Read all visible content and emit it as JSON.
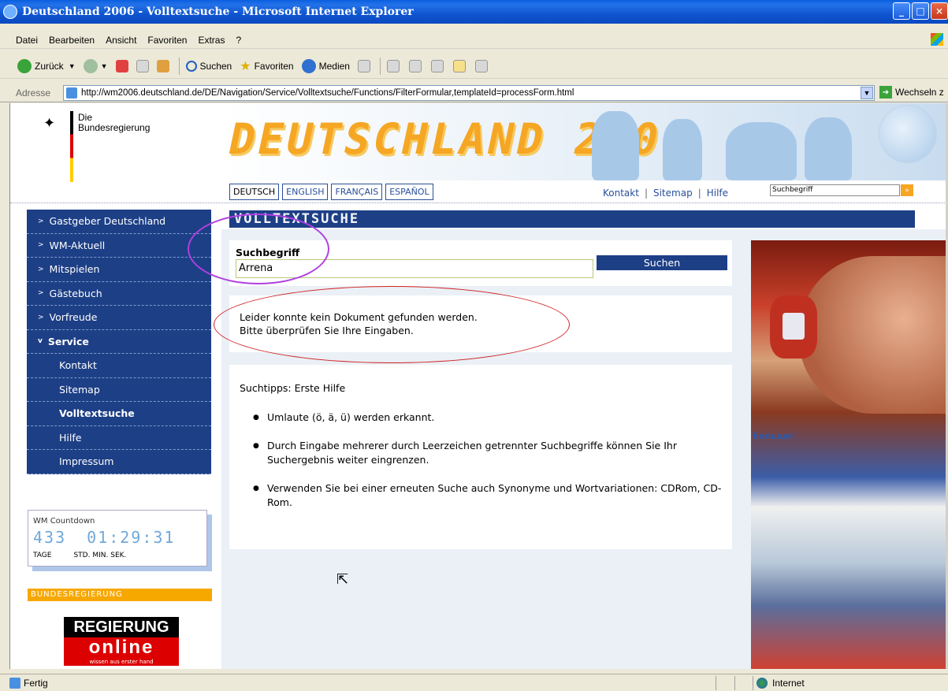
{
  "window": {
    "title": "Deutschland 2006 - Volltextsuche - Microsoft Internet Explorer",
    "buttons": [
      "_",
      "□",
      "×"
    ]
  },
  "menu": [
    "Datei",
    "Bearbeiten",
    "Ansicht",
    "Favoriten",
    "Extras",
    "?"
  ],
  "toolbar": {
    "back": "Zurück",
    "search": "Suchen",
    "favorites": "Favoriten",
    "media": "Medien"
  },
  "address": {
    "label": "Adresse",
    "url": "http://wm2006.deutschland.de/DE/Navigation/Service/Volltextsuche/Functions/FilterFormular,templateId=processForm.html",
    "go": "Wechseln z"
  },
  "header": {
    "logo_line1": "Die",
    "logo_line2": "Bundesregierung",
    "banner": "DEUTSCHLAND 2006",
    "langs": [
      "DEUTSCH",
      "ENGLISH",
      "FRANÇAIS",
      "ESPAÑOL"
    ],
    "links": [
      "Kontakt",
      "Sitemap",
      "Hilfe"
    ],
    "search_placeholder": "Suchbegriff"
  },
  "nav": {
    "items": [
      "Gastgeber Deutschland",
      "WM-Aktuell",
      "Mitspielen",
      "Gästebuch",
      "Vorfreude",
      "Service"
    ],
    "sub": [
      "Kontakt",
      "Sitemap",
      "Volltextsuche",
      "Hilfe",
      "Impressum"
    ]
  },
  "countdown": {
    "title": "WM Countdown",
    "days": "433",
    "time": "01:29:31",
    "labels": [
      "TAGE",
      "STD.",
      "MIN.",
      "SEK."
    ]
  },
  "bundesregierung": {
    "label": "BUNDESREGIERUNG",
    "line1": "REGIERUNG",
    "line2": "online",
    "line3": "wissen aus erster hand"
  },
  "main": {
    "heading": "VOLLTEXTSUCHE",
    "search_label": "Suchbegriff",
    "search_value": "Arrena",
    "search_button": "Suchen",
    "message_line1": "Leider konnte kein Dokument gefunden werden.",
    "message_line2": "Bitte überprüfen Sie Ihre Eingaben.",
    "tips_title": "Suchtipps: Erste Hilfe",
    "tips": [
      "Umlaute (ö, ä, ü) werden erkannt.",
      "Durch Eingabe mehrerer durch Leerzeichen getrennter Suchbegriffe können Sie Ihr Suchergebnis weiter eingrenzen.",
      "Verwenden Sie bei einer erneuten Suche auch Synonyme und Wortvariationen: CDRom, CD-Rom."
    ]
  },
  "photo_text": "больше!",
  "status": {
    "left": "Fertig",
    "zone": "Internet"
  }
}
